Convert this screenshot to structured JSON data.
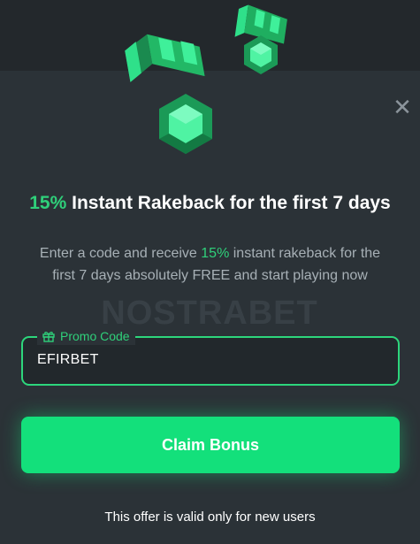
{
  "colors": {
    "accent": "#2fd07a",
    "button": "#13e07b",
    "modal_bg": "#2b3237",
    "top_bg": "#23282c"
  },
  "icons": {
    "close": "close-icon",
    "gift": "gift-icon",
    "gems": "emerald-gems-icon"
  },
  "headline": {
    "percent": "15%",
    "text": " Instant Rakeback for the first 7 days"
  },
  "description": {
    "part1": "Enter a code and receive ",
    "percent": "15%",
    "part2": " instant rakeback for the first 7 days absolutely FREE and start playing now"
  },
  "watermark": "NOSTRABET",
  "promo": {
    "label": "Promo Code",
    "value": "EFIRBET"
  },
  "claim_button": "Claim Bonus",
  "footer_note": "This offer is valid only for new users"
}
